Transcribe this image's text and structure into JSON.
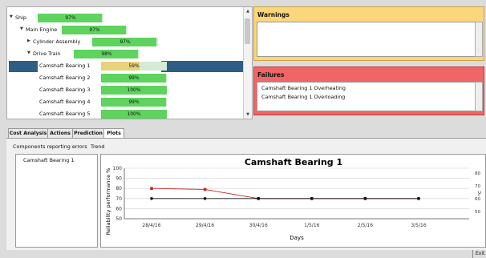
{
  "tree": {
    "rows": [
      {
        "label": "Ship",
        "pct": "97%",
        "value": 0.97,
        "expanded": true
      },
      {
        "label": "Main Engine",
        "pct": "97%",
        "value": 0.97,
        "expanded": true
      },
      {
        "label": "Cylinder Assembly",
        "pct": "97%",
        "value": 0.97,
        "expanded": false
      },
      {
        "label": "Drive Train",
        "pct": "98%",
        "value": 0.98,
        "expanded": true
      },
      {
        "label": "Camshaft Bearing 1",
        "pct": "59%",
        "value": 0.59,
        "selected": true
      },
      {
        "label": "Camshaft Bearing 2",
        "pct": "99%",
        "value": 0.99
      },
      {
        "label": "Camshaft Bearing 3",
        "pct": "100%",
        "value": 1.0
      },
      {
        "label": "Camshaft Bearing 4",
        "pct": "99%",
        "value": 0.99
      },
      {
        "label": "Camshaft Bearing 5",
        "pct": "100%",
        "value": 1.0
      }
    ]
  },
  "warnings": {
    "title": "Warnings",
    "items": []
  },
  "failures": {
    "title": "Failures",
    "items": [
      "Camshaft Bearing 1 Overheating",
      "Camshaft Bearing 1 Overloading"
    ]
  },
  "tabs": [
    {
      "label": "Cost Analysis",
      "active": false
    },
    {
      "label": "Actions",
      "active": false
    },
    {
      "label": "Prediction",
      "active": false
    },
    {
      "label": "Plots",
      "active": true
    }
  ],
  "bottom": {
    "components_header": "Components reporting errors",
    "trend_header": "Trend",
    "error_components": [
      "Camshaft Bearing 1"
    ]
  },
  "colors": {
    "bar_fill": "#5ed35e",
    "bar_bg": "#d4ecd4",
    "warn_bar": "#e8d27a",
    "selection": "#2d5e86",
    "warnings_bg": "#fbd67a",
    "failures_bg": "#f06565",
    "series_red": "#cc2222",
    "series_black": "#111111"
  },
  "chart_data": {
    "type": "line",
    "title": "Camshaft Bearing 1",
    "xlabel": "Days",
    "ylabel": "Reliability performance %",
    "categories": [
      "28/4/16",
      "29/4/16",
      "30/4/16",
      "1/5/16",
      "2/5/16",
      "3/5/16"
    ],
    "ylim": [
      50,
      100
    ],
    "yticks": [
      50,
      60,
      70,
      80,
      90,
      100
    ],
    "right_ticks": [
      "80",
      "70",
      "60",
      "50"
    ],
    "right_label": "°C",
    "series": [
      {
        "values": [
          80,
          79,
          70,
          70,
          70,
          70
        ],
        "color": "#cc2222"
      },
      {
        "values": [
          70,
          70,
          70,
          70,
          70,
          70
        ],
        "color": "#111111"
      }
    ],
    "grid": true
  },
  "status": {
    "exit_label": "Exit"
  }
}
